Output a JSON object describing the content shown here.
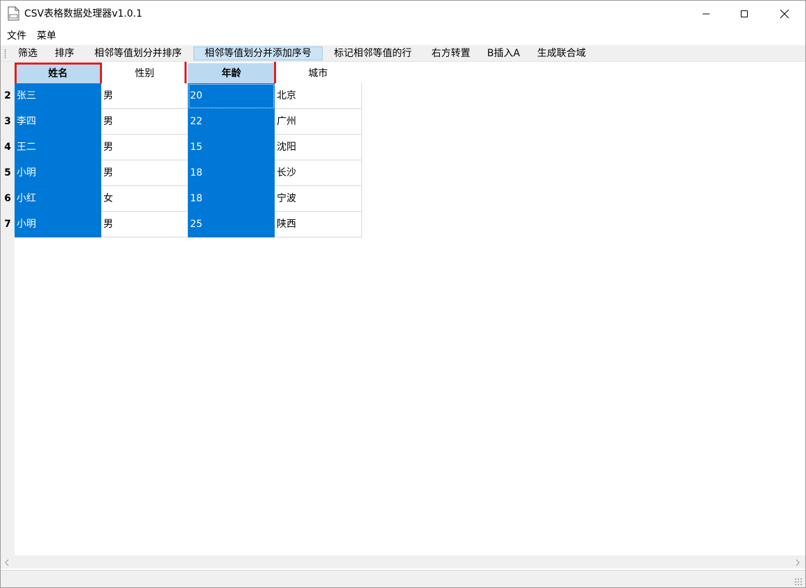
{
  "window": {
    "title": "CSV表格数据处理器v1.0.1",
    "controls": [
      "minimize-icon",
      "maximize-icon",
      "close-icon"
    ]
  },
  "menu": {
    "items": [
      {
        "label": "文件"
      },
      {
        "label": "菜单"
      }
    ]
  },
  "toolbar": {
    "active_index": 3,
    "buttons": [
      {
        "label": "筛选"
      },
      {
        "label": "排序"
      },
      {
        "label": "相邻等值划分并排序"
      },
      {
        "label": "相邻等值划分并添加序号"
      },
      {
        "label": "标记相邻等值的行"
      },
      {
        "label": "右方转置"
      },
      {
        "label": "B插入A"
      },
      {
        "label": "生成联合域"
      }
    ]
  },
  "table": {
    "columns": [
      {
        "label": "姓名",
        "selected": true
      },
      {
        "label": "性别",
        "selected": false
      },
      {
        "label": "年龄",
        "selected": true
      },
      {
        "label": "城市",
        "selected": false
      }
    ],
    "rows": [
      {
        "num": "2",
        "cells": [
          "张三",
          "男",
          "20",
          "北京"
        ]
      },
      {
        "num": "3",
        "cells": [
          "李四",
          "男",
          "22",
          "广州"
        ]
      },
      {
        "num": "4",
        "cells": [
          "王二",
          "男",
          "15",
          "沈阳"
        ]
      },
      {
        "num": "5",
        "cells": [
          "小明",
          "男",
          "18",
          "长沙"
        ]
      },
      {
        "num": "6",
        "cells": [
          "小红",
          "女",
          "18",
          "宁波"
        ]
      },
      {
        "num": "7",
        "cells": [
          "小明",
          "男",
          "25",
          "陕西"
        ]
      }
    ]
  },
  "colors": {
    "selection": "#0078d7",
    "selected_header": "#bcd9f2",
    "highlight_border": "#e0201c",
    "toolbar_active": "#cce4f7"
  }
}
